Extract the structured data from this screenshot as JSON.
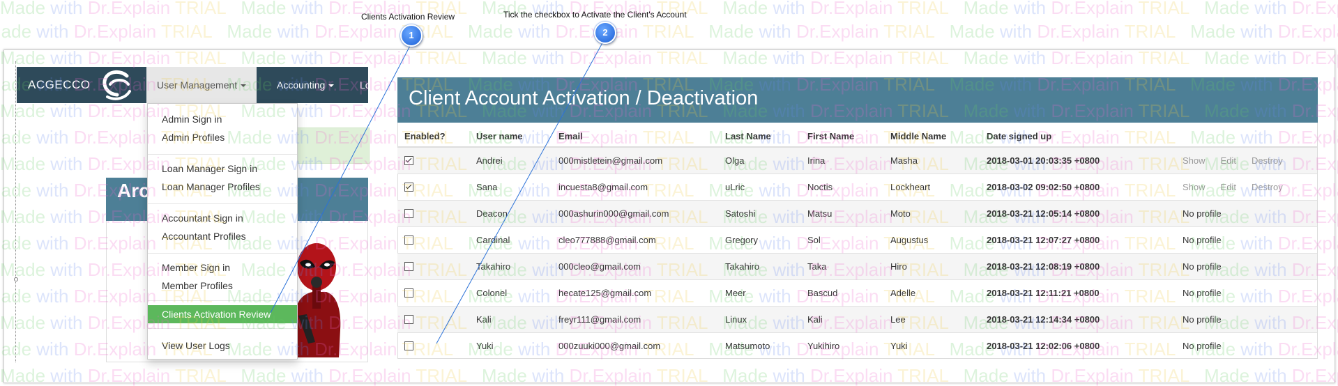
{
  "callouts": [
    {
      "number": "1",
      "label": "Clients Activation Review"
    },
    {
      "number": "2",
      "label": "Tick the checkbox to Activate the Client's Account"
    }
  ],
  "watermark": {
    "parts": [
      "Made",
      "with",
      "Dr.Explain",
      "TRIAL"
    ]
  },
  "navbar": {
    "brand": "ACGECCO",
    "logo_icon": "acgecco-logo-icon",
    "items": [
      {
        "label": "User Management",
        "active": true
      },
      {
        "label": "Accounting"
      },
      {
        "label": "Lo"
      }
    ]
  },
  "background_page": {
    "panel_title": "Arc"
  },
  "dropdown": {
    "items": [
      "Admin Sign in",
      "Admin Profiles",
      "Loan Manager Sign in",
      "Loan Manager Profiles",
      "Accountant Sign in",
      "Accountant Profiles",
      "Member Sign in",
      "Member Profiles",
      "Clients Activation Review",
      "View User Logs"
    ],
    "active_item": "Clients Activation Review"
  },
  "panel": {
    "title": "Client Account Activation / Deactivation",
    "columns": [
      "Enabled?",
      "User name",
      "Email",
      "Last Name",
      "First Name",
      "Middle Name",
      "Date signed up",
      "",
      ""
    ],
    "rows": [
      {
        "enabled": true,
        "username": "Andrei",
        "email": "000mistletein@gmail.com",
        "last": "Olga",
        "first": "Irina",
        "middle": "Masha",
        "date": "2018-03-01 20:03:35 +0800",
        "actions": [
          "Show",
          "Edit",
          "Destroy"
        ]
      },
      {
        "enabled": true,
        "username": "Sana",
        "email": "incuesta8@gmail.com",
        "last": "uLric",
        "first": "Noctis",
        "middle": "Lockheart",
        "date": "2018-03-02 09:02:50 +0800",
        "actions": [
          "Show",
          "Edit",
          "Destroy"
        ]
      },
      {
        "enabled": false,
        "username": "Deacon",
        "email": "000ashurin000@gmail.com",
        "last": "Satoshi",
        "first": "Matsu",
        "middle": "Moto",
        "date": "2018-03-21 12:05:14 +0800",
        "status": "No profile"
      },
      {
        "enabled": false,
        "username": "Cardinal",
        "email": "cleo777888@gmail.com",
        "last": "Gregory",
        "first": "Sol",
        "middle": "Augustus",
        "date": "2018-03-21 12:07:27 +0800",
        "status": "No profile"
      },
      {
        "enabled": false,
        "username": "Takahiro",
        "email": "000cleo@gmail.com",
        "last": "Takahiro",
        "first": "Taka",
        "middle": "Hiro",
        "date": "2018-03-21 12:08:19 +0800",
        "status": "No profile"
      },
      {
        "enabled": false,
        "username": "Colonel",
        "email": "hecate125@gmail.com",
        "last": "Meer",
        "first": "Bascud",
        "middle": "Adelle",
        "date": "2018-03-21 12:11:21 +0800",
        "status": "No profile"
      },
      {
        "enabled": false,
        "username": "Kali",
        "email": "freyr111@gmail.com",
        "last": "Linux",
        "first": "Kali",
        "middle": "Lee",
        "date": "2018-03-21 12:14:34 +0800",
        "status": "No profile"
      },
      {
        "enabled": false,
        "username": "Yuki",
        "email": "000zuuki000@gmail.com",
        "last": "Matsumoto",
        "first": "Yukihiro",
        "middle": "Yuki",
        "date": "2018-03-21 12:02:06 +0800",
        "status": "No profile"
      }
    ]
  },
  "colors": {
    "navbar": "#2e4a5a",
    "panel_header": "#4d7f96",
    "active_item": "#5cb85c",
    "callout_badge": "#1b5fd6"
  }
}
